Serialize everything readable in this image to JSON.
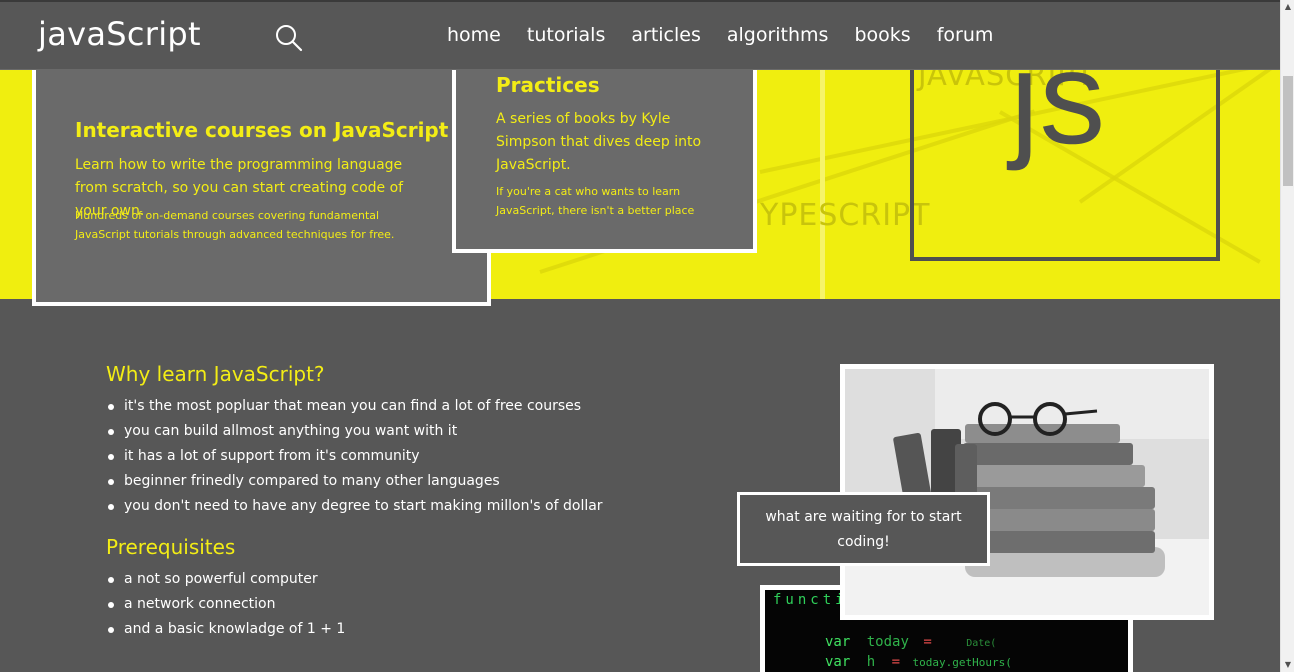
{
  "header": {
    "logo": "javaScript",
    "nav": [
      {
        "label": "home"
      },
      {
        "label": "tutorials"
      },
      {
        "label": "articles"
      },
      {
        "label": "algorithms"
      },
      {
        "label": "books"
      },
      {
        "label": "forum"
      }
    ]
  },
  "hero": {
    "card1": {
      "title": "Interactive courses on JavaScript",
      "text": "Learn how to write the programming language from scratch, so you can start creating code of your own.",
      "small": "Hundreds of on-demand courses covering fundamental JavaScript tutorials through advanced techniques for free."
    },
    "card2": {
      "title": "Practices",
      "text": "A series of books by Kyle Simpson that dives deep into JavaScript.",
      "small": "If you're a cat who wants to learn JavaScript, there isn't a better place"
    },
    "js_logo": "js",
    "ghost_javascript": "JAVASCRIPT",
    "ghost_typescript": "YPESCRIPT"
  },
  "main": {
    "why": {
      "title": "Why learn JavaScript?",
      "items": [
        "it's the most popluar that mean you can find a lot of free courses",
        "you can build allmost anything you want with it",
        "it has a lot of support from it's community",
        "beginner frinedly compared to many other languages",
        "you don't need to have any degree to start making millon's of dollar"
      ]
    },
    "prereq": {
      "title": "Prerequisites",
      "items": [
        "a not so powerful computer",
        "a network connection",
        "and a basic knowladge of 1 + 1"
      ]
    }
  },
  "cta": {
    "text": "what are waiting for to start coding!"
  },
  "code": {
    "line1": "functi",
    "line2_kw": "var",
    "line2_var": "today",
    "line2_op": "=",
    "line2_new": "Date(",
    "line3_kw": "var",
    "line3_var": "h",
    "line3_op": "=",
    "line3_call": "today.getHours("
  },
  "colors": {
    "accent": "#f3ed15",
    "background": "#575757",
    "hero": "#f0ee0f"
  }
}
